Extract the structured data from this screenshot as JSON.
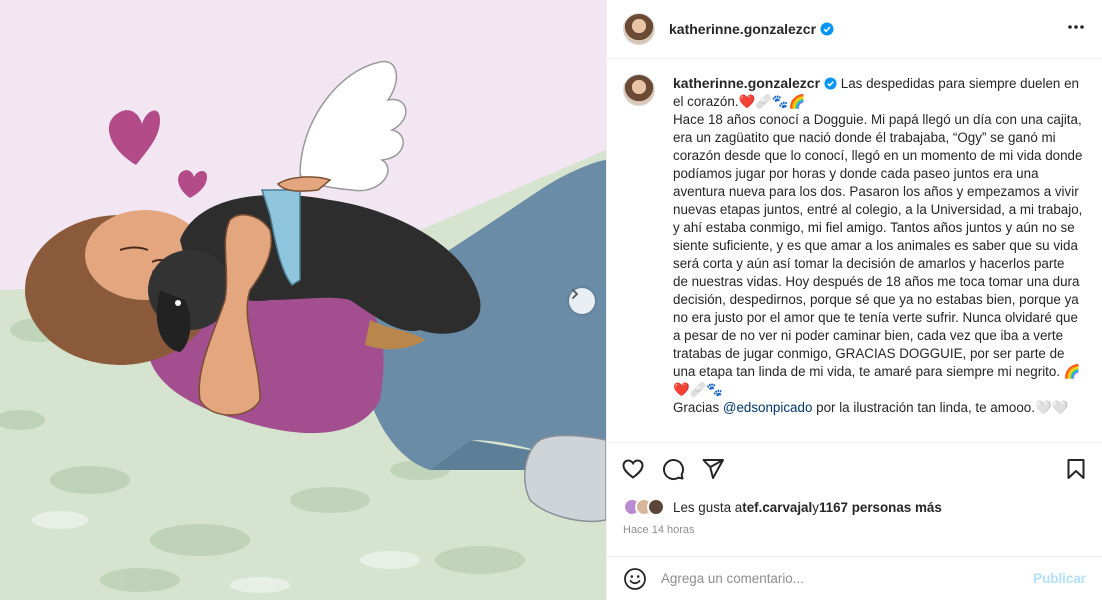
{
  "post": {
    "username": "katherinne.gonzalezcr",
    "verified_icon": "verified-badge-icon",
    "more_icon": "more-options-icon",
    "media_next_icon": "chevron-right-icon"
  },
  "caption": {
    "username": "katherinne.gonzalezcr",
    "lead": " Las despedidas para siempre duelen en el corazón.❤️🩹🐾🌈",
    "p1": "Hace 18 años conocí a Dogguie. Mi papá llegó un día con una cajita, era un zagüatito que nació donde él trabajaba, “Ogy” se ganó mi corazón desde que lo conocí, llegó en un momento de mi vida donde podíamos jugar por horas y donde cada paseo juntos era una aventura nueva para los dos. Pasaron los años y empezamos a vivir nuevas etapas juntos, entré al colegio, a la Universidad, a mi trabajo, y ahí estaba conmigo, mi fiel amigo. Tantos años juntos y aún no se siente suficiente, y es que amar a los animales es saber que su vida será corta y aún así tomar la decisión de amarlos y hacerlos parte de nuestras vidas. Hoy después de 18 años me toca tomar una dura decisión, despedirnos, porque sé que ya no estabas bien, porque ya no era justo por el amor que te tenía verte sufrir. Nunca olvidaré que a pesar de no ver ni poder caminar bien, cada vez que iba a verte tratabas de jugar conmigo, GRACIAS DOGGUIE, por ser parte de una etapa tan linda de mi vida, te amaré para siempre mi negrito. 🌈❤️🩹🐾",
    "thanks_prefix": "Gracias ",
    "thanks_mention": "@edsonpicado",
    "thanks_suffix": " por la ilustración tan linda, te amooo.🤍🤍"
  },
  "actions": {
    "like_icon": "heart-icon",
    "comment_icon": "comment-icon",
    "share_icon": "send-icon",
    "save_icon": "bookmark-icon"
  },
  "likes": {
    "prefix": "Les gusta a ",
    "first_user": "tef.carvajal",
    "middle": " y ",
    "others": "1167 personas más"
  },
  "timestamp": "Hace 14 horas",
  "comment_box": {
    "emoji_icon": "emoji-icon",
    "placeholder": "Agrega un comentario...",
    "publish_label": "Publicar"
  },
  "colors": {
    "publish_disabled": "#b2dffc",
    "mention": "#00376b",
    "verified": "#0095f6",
    "media_background": "#f2e6f3"
  }
}
